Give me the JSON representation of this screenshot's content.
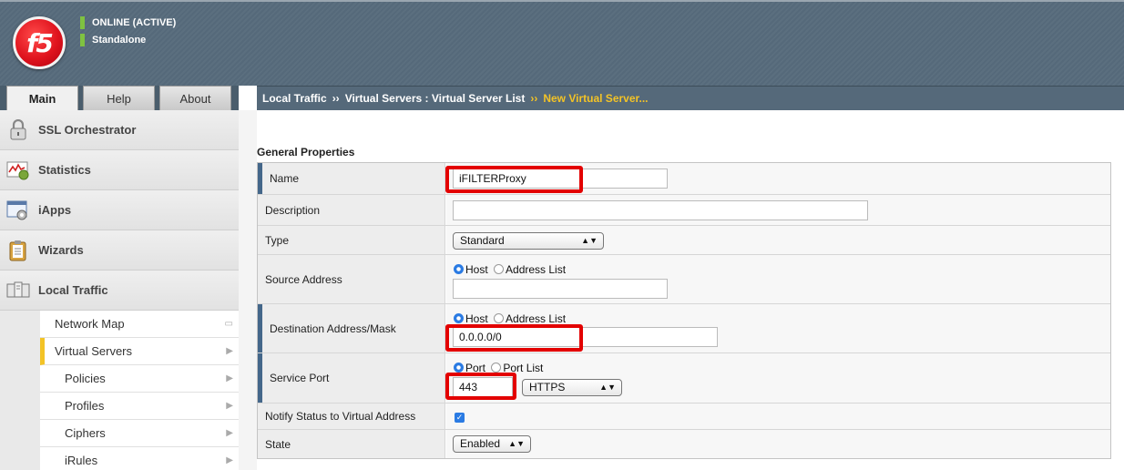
{
  "header": {
    "logo_text": "f5",
    "status_line1": "ONLINE (ACTIVE)",
    "status_line2": "Standalone"
  },
  "tabs": [
    {
      "label": "Main",
      "active": true
    },
    {
      "label": "Help",
      "active": false
    },
    {
      "label": "About",
      "active": false
    }
  ],
  "breadcrumb": {
    "part1": "Local Traffic",
    "sep1": "››",
    "part2": "Virtual Servers : Virtual Server List",
    "sep2": "››",
    "current": "New Virtual Server..."
  },
  "sidebar": {
    "items": [
      {
        "label": "SSL Orchestrator",
        "icon": "lock-icon"
      },
      {
        "label": "Statistics",
        "icon": "chart-icon"
      },
      {
        "label": "iApps",
        "icon": "gear-window-icon"
      },
      {
        "label": "Wizards",
        "icon": "clipboard-icon"
      },
      {
        "label": "Local Traffic",
        "icon": "servers-icon"
      }
    ],
    "sub_items": [
      {
        "label": "Network Map",
        "indent": false
      },
      {
        "label": "Virtual Servers",
        "indent": false,
        "active": true
      },
      {
        "label": "Policies",
        "indent": true
      },
      {
        "label": "Profiles",
        "indent": true
      },
      {
        "label": "Ciphers",
        "indent": true
      },
      {
        "label": "iRules",
        "indent": true
      }
    ]
  },
  "form": {
    "section_title": "General Properties",
    "name_label": "Name",
    "name_value": "iFILTERProxy",
    "description_label": "Description",
    "description_value": "",
    "type_label": "Type",
    "type_value": "Standard",
    "source_label": "Source Address",
    "source_radio_host": "Host",
    "source_radio_list": "Address List",
    "source_value": "",
    "dest_label": "Destination Address/Mask",
    "dest_radio_host": "Host",
    "dest_radio_list": "Address List",
    "dest_value": "0.0.0.0/0",
    "port_label": "Service Port",
    "port_radio_port": "Port",
    "port_radio_list": "Port List",
    "port_value": "443",
    "port_service": "HTTPS",
    "notify_label": "Notify Status to Virtual Address",
    "notify_checked": true,
    "state_label": "State",
    "state_value": "Enabled"
  },
  "colors": {
    "header_bg": "#5b6f7f",
    "accent_yellow": "#f3c326",
    "status_green": "#7fc241",
    "highlight_red": "#e30000",
    "radio_blue": "#2b7be3"
  }
}
